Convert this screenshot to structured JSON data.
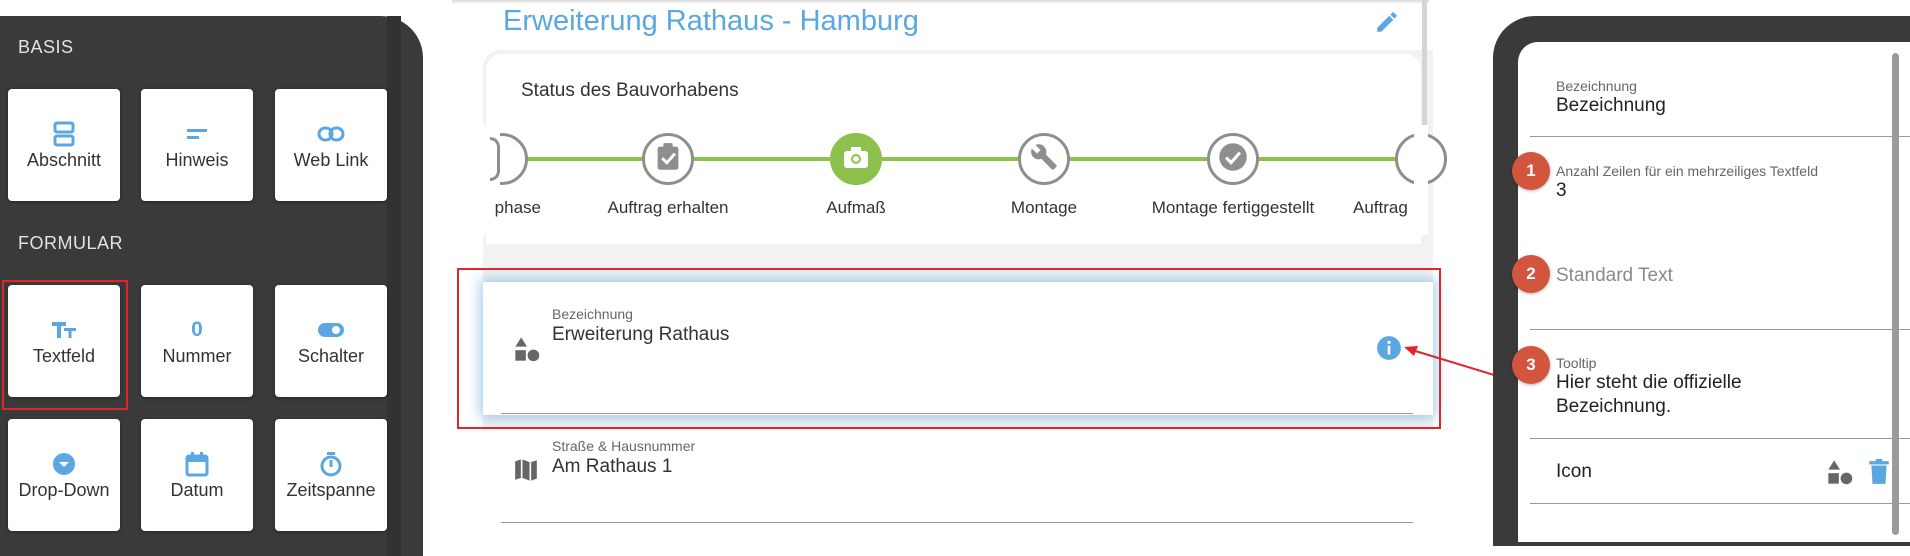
{
  "palette": {
    "left_panel": {
      "section_basis": "BASIS",
      "section_formular": "FORMULAR",
      "basis_items": [
        {
          "label": "Abschnitt",
          "icon": "section-icon"
        },
        {
          "label": "Hinweis",
          "icon": "note-icon"
        },
        {
          "label": "Web Link",
          "icon": "link-icon"
        }
      ],
      "formular_items": [
        {
          "label": "Textfeld",
          "icon": "text-field-icon"
        },
        {
          "label": "Nummer",
          "icon": "number-icon",
          "glyph": "0"
        },
        {
          "label": "Schalter",
          "icon": "toggle-icon"
        },
        {
          "label": "Drop-Down",
          "icon": "dropdown-icon"
        },
        {
          "label": "Datum",
          "icon": "calendar-icon"
        },
        {
          "label": "Zeitspanne",
          "icon": "stopwatch-icon"
        }
      ]
    }
  },
  "project": {
    "title": "Erweiterung Rathaus - Hamburg",
    "status_title": "Status des Bauvorhabens",
    "steps": [
      {
        "label": "phase",
        "icon": "partial-step-icon",
        "state": "done"
      },
      {
        "label": "Auftrag erhalten",
        "icon": "clipboard-check-icon",
        "state": "done"
      },
      {
        "label": "Aufmaß",
        "icon": "camera-icon",
        "state": "active"
      },
      {
        "label": "Montage",
        "icon": "wrench-icon",
        "state": "pending"
      },
      {
        "label": "Montage fertiggestellt",
        "icon": "check-circle-icon",
        "state": "pending"
      },
      {
        "label": "Auftrag",
        "icon": "partial-step-icon",
        "state": "pending"
      }
    ],
    "fields": [
      {
        "label": "Bezeichnung",
        "value": "Erweiterung Rathaus",
        "icon": "shapes-icon",
        "info_icon": "info-icon"
      },
      {
        "label": "Straße & Hausnummer",
        "value": "Am Rathaus 1",
        "icon": "map-icon"
      }
    ]
  },
  "properties": {
    "items": [
      {
        "label": "Bezeichnung",
        "value": "Bezeichnung"
      },
      {
        "badge": "1",
        "label": "Anzahl Zeilen für ein mehrzeiliges Textfeld",
        "value": "3"
      },
      {
        "badge": "2",
        "placeholder": "Standard Text"
      },
      {
        "badge": "3",
        "label": "Tooltip",
        "value_line1": "Hier steht die offizielle",
        "value_line2": "Bezeichnung."
      },
      {
        "label": "Icon",
        "icon": "shapes-icon",
        "action_icon": "trash-icon"
      }
    ]
  },
  "colors": {
    "accent_blue": "#5aa7e2",
    "step_active": "#8dc04d",
    "step_line": "#8dc04d",
    "highlight_red": "#e0262d",
    "badge": "#d2553d",
    "panel_dark": "#3a3a3a"
  }
}
